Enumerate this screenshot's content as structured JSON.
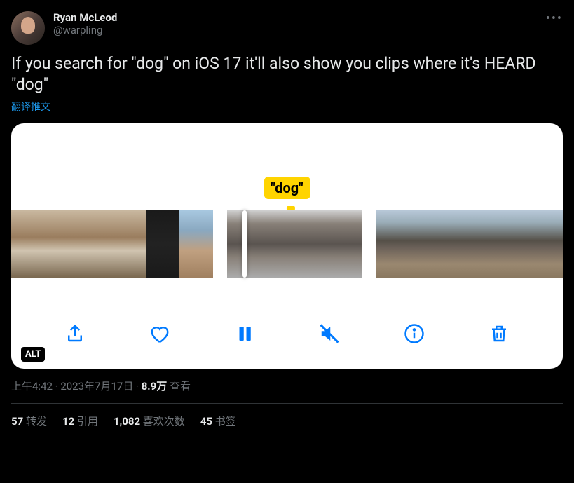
{
  "user": {
    "display_name": "Ryan McLeod",
    "handle": "@warpling"
  },
  "tweet_text": "If you search for \"dog\" on iOS 17 it'll also show you clips where it's HEARD \"dog\"",
  "translate_label": "翻译推文",
  "media": {
    "tag_label": "\"dog\"",
    "alt_badge": "ALT"
  },
  "meta": {
    "time": "上午4:42",
    "date": "2023年7月17日",
    "views_count": "8.9万",
    "views_label": "查看"
  },
  "stats": {
    "retweets_count": "57",
    "retweets_label": "转发",
    "quotes_count": "12",
    "quotes_label": "引用",
    "likes_count": "1,082",
    "likes_label": "喜欢次数",
    "bookmarks_count": "45",
    "bookmarks_label": "书签"
  }
}
